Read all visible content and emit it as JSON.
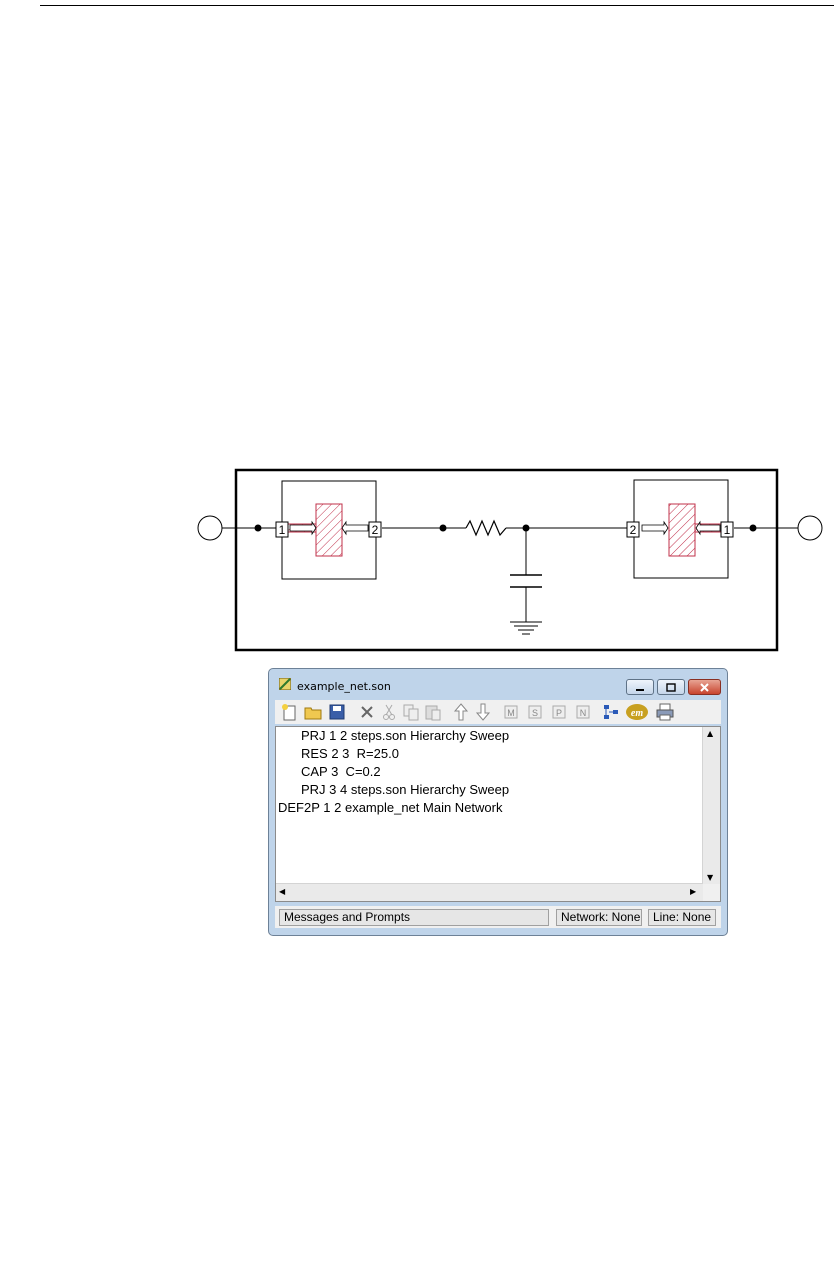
{
  "window": {
    "title": "example_net.son"
  },
  "toolbar": {
    "buttons": [
      "new-file-icon",
      "open-folder-icon",
      "save-icon",
      "delete-icon",
      "cut-icon",
      "copy-icon",
      "paste-icon",
      "move-up-icon",
      "move-down-icon",
      "m-icon",
      "s-icon",
      "p-icon",
      "n-icon",
      "network-icon",
      "em-icon",
      "print-icon"
    ],
    "text_labels": {
      "m": "M",
      "s": "S",
      "p": "P",
      "n": "N",
      "em": "em"
    }
  },
  "editor": {
    "lines": [
      "PRJ 1 2 steps.son Hierarchy Sweep",
      "RES 2 3  R=25.0",
      "CAP 3  C=0.2",
      "PRJ 3 4 steps.son Hierarchy Sweep",
      "DEF2P 1 2 example_net Main Network"
    ]
  },
  "status": {
    "messages": "Messages and Prompts",
    "network": "Network: None",
    "line": "Line: None"
  },
  "schematic": {
    "left_box": {
      "port_left": "1",
      "port_right": "2"
    },
    "right_box": {
      "port_left": "2",
      "port_right": "1"
    }
  }
}
